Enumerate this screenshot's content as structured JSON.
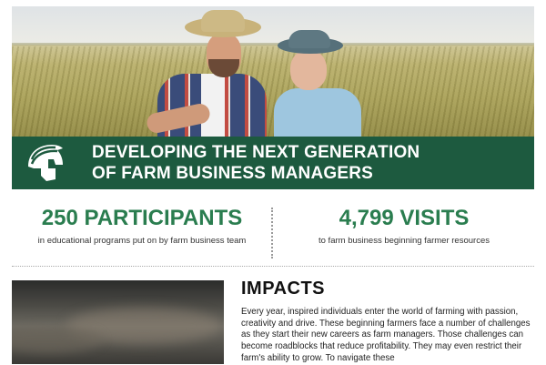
{
  "banner": {
    "title_line1": "DEVELOPING THE NEXT GENERATION",
    "title_line2": "OF FARM BUSINESS MANAGERS",
    "logo_icon": "spartan-helmet-icon",
    "color": "#1d5a3f"
  },
  "stats": [
    {
      "number": "250 PARTICIPANTS",
      "description": "in educational programs put on by farm business team"
    },
    {
      "number": "4,799 VISITS",
      "description": "to farm business beginning farmer resources"
    }
  ],
  "stat_color": "#2a7d4f",
  "impacts": {
    "title": "IMPACTS",
    "body": "Every year, inspired individuals enter the world of farming with passion, creativity and drive. These beginning farmers face a number of challenges as they start their new careers as farm managers. Those challenges can become roadblocks that reduce profitability. They may even restrict their farm's ability to grow. To navigate these"
  }
}
